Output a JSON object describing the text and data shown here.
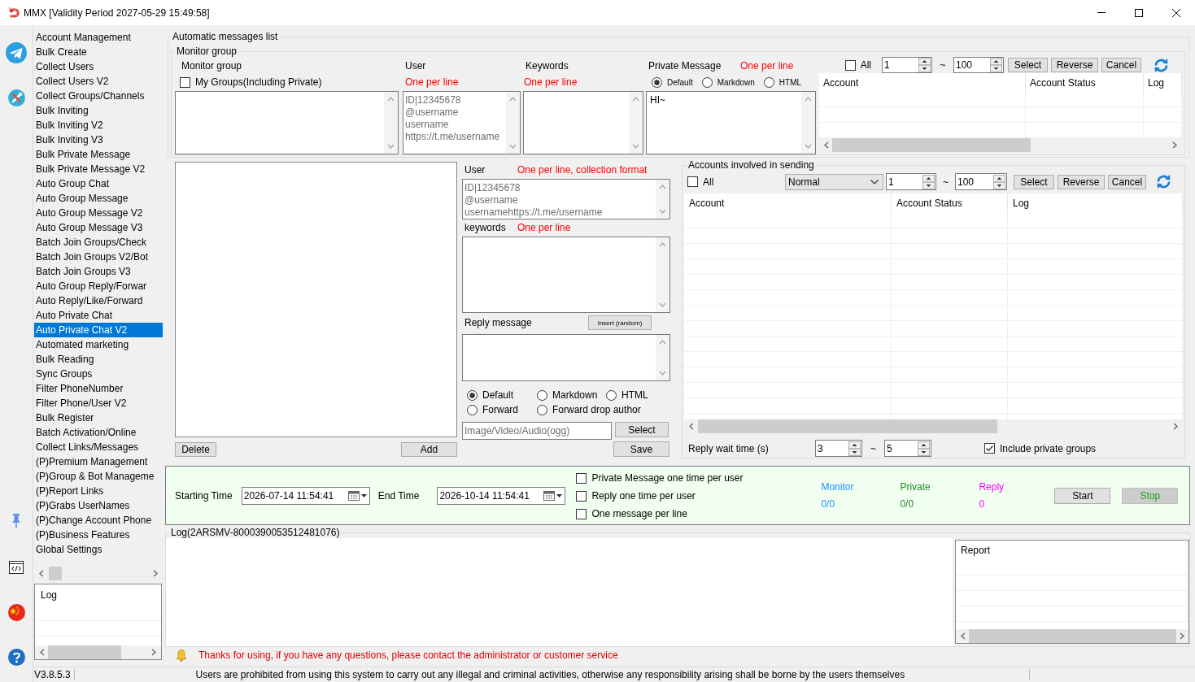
{
  "window": {
    "title": "MMX [Validity Period 2027-05-29 15:49:58]"
  },
  "sidebar": {
    "items": [
      {
        "label": "Account Management",
        "selected": false
      },
      {
        "label": "Bulk Create",
        "selected": false
      },
      {
        "label": "Collect Users",
        "selected": false
      },
      {
        "label": "Collect Users V2",
        "selected": false
      },
      {
        "label": "Collect Groups/Channels",
        "selected": false
      },
      {
        "label": "Bulk Inviting",
        "selected": false
      },
      {
        "label": "Bulk Inviting V2",
        "selected": false
      },
      {
        "label": "Bulk Inviting V3",
        "selected": false
      },
      {
        "label": "Bulk Private Message",
        "selected": false
      },
      {
        "label": "Bulk Private Message V2",
        "selected": false
      },
      {
        "label": "Auto Group Chat",
        "selected": false
      },
      {
        "label": "Auto Group Message",
        "selected": false
      },
      {
        "label": "Auto Group Message V2",
        "selected": false
      },
      {
        "label": "Auto Group Message V3",
        "selected": false
      },
      {
        "label": "Batch Join Groups/Check",
        "selected": false
      },
      {
        "label": "Batch Join Groups V2/Bot",
        "selected": false
      },
      {
        "label": "Batch Join Groups V3",
        "selected": false
      },
      {
        "label": "Auto Group Reply/Forwar",
        "selected": false
      },
      {
        "label": "Auto Reply/Like/Forward",
        "selected": false
      },
      {
        "label": "Auto Private Chat",
        "selected": false
      },
      {
        "label": "Auto Private Chat V2",
        "selected": true
      },
      {
        "label": "Automated marketing",
        "selected": false
      },
      {
        "label": "Bulk Reading",
        "selected": false
      },
      {
        "label": "Sync Groups",
        "selected": false
      },
      {
        "label": "Filter PhoneNumber",
        "selected": false
      },
      {
        "label": "Filter Phone/User V2",
        "selected": false
      },
      {
        "label": "Bulk Register",
        "selected": false
      },
      {
        "label": "Batch Activation/Online",
        "selected": false
      },
      {
        "label": "Collect Links/Messages",
        "selected": false
      },
      {
        "label": "(P)Premium Management",
        "selected": false
      },
      {
        "label": "(P)Group & Bot Manageme",
        "selected": false
      },
      {
        "label": "(P)Report Links",
        "selected": false
      },
      {
        "label": "(P)Grabs UserNames",
        "selected": false
      },
      {
        "label": "(P)Change Account Phone",
        "selected": false
      },
      {
        "label": "(P)Business Features",
        "selected": false
      },
      {
        "label": "Global Settings",
        "selected": false
      }
    ],
    "log_columns": [
      "Log"
    ]
  },
  "automatic_messages": {
    "title": "Automatic messages list",
    "monitor_group": {
      "title": "Monitor group",
      "groups": {
        "label": "Monitor group",
        "my_groups": {
          "label": "My Groups(Including Private)",
          "checked": false
        }
      },
      "user": {
        "label": "User",
        "hint": "One per line",
        "placeholder": "ID|12345678\n@username\nusername\nhttps://t.me/username"
      },
      "keywords": {
        "label": "Keywords",
        "hint": "One per line"
      },
      "private_message": {
        "label": "Private Message",
        "hint": "One per line",
        "formats": [
          {
            "label": "Default",
            "selected": true
          },
          {
            "label": "Markdown",
            "selected": false
          },
          {
            "label": "HTML",
            "selected": false
          }
        ],
        "value": "HI~"
      }
    },
    "accounts": {
      "select_all": {
        "label": "All",
        "checked": false
      },
      "range_from": "1",
      "range_separator": "~",
      "range_to": "100",
      "buttons": [
        "Select",
        "Reverse",
        "Cancel"
      ],
      "columns": [
        "Account",
        "Account Status",
        "Log"
      ]
    }
  },
  "message_list": {
    "buttons": [
      "Delete",
      "Add"
    ]
  },
  "reply_editor": {
    "user": {
      "label": "User",
      "hint": "One per line, collection format",
      "placeholder": "ID|12345678\n@username\nusernamehttps://t.me/username"
    },
    "keywords": {
      "label": "keywords",
      "hint": "One per line"
    },
    "reply_message": {
      "label": "Reply message",
      "insert_button": "Insert (random)"
    },
    "formats": [
      {
        "label": "Default",
        "selected": true
      },
      {
        "label": "Markdown",
        "selected": false
      },
      {
        "label": "HTML",
        "selected": false
      },
      {
        "label": "Forward",
        "selected": false
      },
      {
        "label": "Forward drop author",
        "selected": false
      }
    ],
    "media": {
      "placeholder": "Image/Video/Audio(ogg)",
      "button": "Select"
    },
    "save_button": "Save"
  },
  "sending_accounts": {
    "title": "Accounts involved in sending",
    "select_all": {
      "label": "All",
      "checked": false
    },
    "status_filter": "Normal",
    "range_from": "1",
    "range_separator": "~",
    "range_to": "100",
    "buttons": [
      "Select",
      "Reverse",
      "Cancel"
    ],
    "columns": [
      "Account",
      "Account Status",
      "Log"
    ],
    "wait_time": {
      "label": "Reply wait time (s)",
      "from": "3",
      "separator": "~",
      "to": "5"
    },
    "include_private_groups": {
      "label": "Include private groups",
      "checked": true
    }
  },
  "schedule": {
    "start": {
      "label": "Starting Time",
      "value": "2026-07-14 11:54:41"
    },
    "end": {
      "label": "End Time",
      "value": "2026-10-14 11:54:41"
    },
    "options": [
      {
        "label": "Private Message one time per user",
        "checked": false
      },
      {
        "label": "Reply one time per user",
        "checked": false
      },
      {
        "label": "One message per line",
        "checked": false
      }
    ],
    "stats": [
      {
        "label": "Monitor",
        "value": "0/0",
        "color": "#1e90ff"
      },
      {
        "label": "Private",
        "value": "0/0",
        "color": "#228b22"
      },
      {
        "label": "Reply",
        "value": "0",
        "color": "#ff00ff"
      }
    ],
    "buttons": [
      {
        "label": "Start",
        "disabled": false,
        "color": "#000000"
      },
      {
        "label": "Stop",
        "disabled": true,
        "color": "#20a020"
      }
    ]
  },
  "log": {
    "title": "Log(2ARSMV-8000390053512481076)",
    "report_columns": [
      "Report"
    ]
  },
  "notice": "Thanks for using, if you have any questions, please contact the administrator or customer service",
  "status_bar": {
    "version": "V3.8.5.3",
    "message": "Users are prohibited from using this system to carry out any illegal and criminal activities, otherwise any responsibility arising shall be borne by the users themselves"
  }
}
